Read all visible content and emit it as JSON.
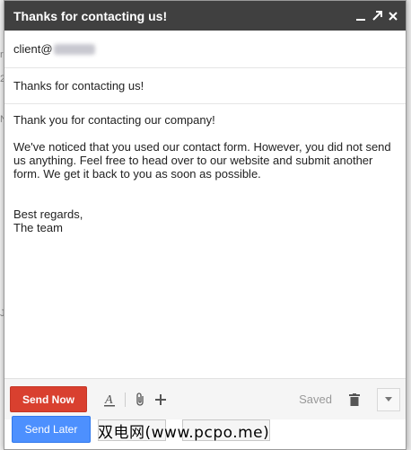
{
  "window": {
    "title": "Thanks for contacting us!",
    "icons": [
      "minimize-icon",
      "popout-icon",
      "close-icon"
    ]
  },
  "to": {
    "value_prefix": "client@"
  },
  "subject": {
    "value": "Thanks for contacting us!"
  },
  "body": {
    "line1": "Thank you for contacting our company!",
    "paragraph2": "We've noticed that you used our contact form. However, you did not send us anything. Feel free to head over to our website and submit another form. We get it back to you as soon as possible.",
    "signoff": "Best regards,",
    "signature": "The team"
  },
  "toolbar": {
    "send_now_label": "Send Now",
    "send_later_label": "Send Later",
    "saved_label": "Saved"
  },
  "watermark": "双电网(www.pcpo.me)",
  "colors": {
    "titlebar": "#404040",
    "send_now": "#d9402f",
    "send_later": "#4d90fe"
  }
}
